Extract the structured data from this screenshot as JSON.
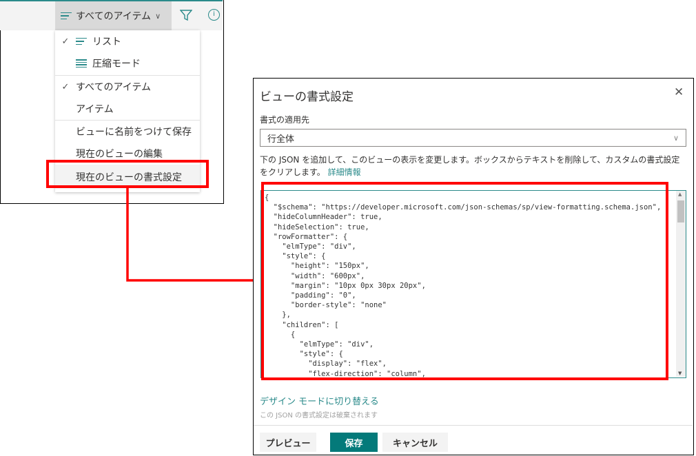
{
  "toolbar": {
    "view_label": "すべてのアイテム",
    "filter_icon": "filter-icon",
    "info_icon": "info-icon",
    "accent": "#2a8a8a"
  },
  "menu": {
    "items": [
      {
        "label": "リスト",
        "checked": true,
        "icon": "list-icon"
      },
      {
        "label": "圧縮モード",
        "checked": false,
        "icon": "compact-list-icon"
      },
      {
        "label": "すべてのアイテム",
        "checked": true
      },
      {
        "label": "アイテム",
        "checked": false
      },
      {
        "label": "ビューに名前をつけて保存"
      },
      {
        "label": "現在のビューの編集"
      },
      {
        "label": "現在のビューの書式設定",
        "highlighted": true
      }
    ]
  },
  "dialog": {
    "title": "ビューの書式設定",
    "apply_label": "書式の適用先",
    "apply_value": "行全体",
    "description": "下の JSON を追加して、このビューの表示を変更します。ボックスからテキストを削除して、カスタムの書式設定をクリアします。",
    "more_info": "詳細情報",
    "code_lines": [
      "{",
      "  \"$schema\": \"https://developer.microsoft.com/json-schemas/sp/view-formatting.schema.json\",",
      "  \"hideColumnHeader\": true,",
      "  \"hideSelection\": true,",
      "  \"rowFormatter\": {",
      "    \"elmType\": \"div\",",
      "    \"style\": {",
      "      \"height\": \"150px\",",
      "      \"width\": \"600px\",",
      "      \"margin\": \"10px 0px 30px 20px\",",
      "      \"padding\": \"0\",",
      "      \"border-style\": \"none\"",
      "    },",
      "    \"children\": [",
      "      {",
      "        \"elmType\": \"div\",",
      "        \"style\": {",
      "          \"display\": \"flex\",",
      "          \"flex-direction\": \"column\","
    ],
    "design_mode_link": "デザイン モードに切り替える",
    "discard_note": "この JSON の書式設定は破棄されます",
    "buttons": {
      "preview": "プレビュー",
      "save": "保存",
      "cancel": "キャンセル"
    },
    "highlight_color": "#ff0000"
  }
}
